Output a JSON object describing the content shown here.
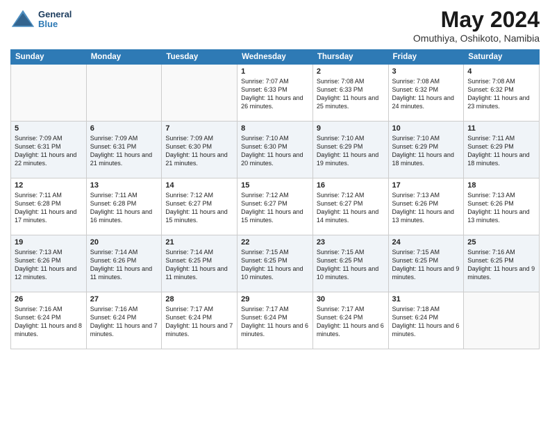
{
  "header": {
    "logo_general": "General",
    "logo_blue": "Blue",
    "title": "May 2024",
    "location": "Omuthiya, Oshikoto, Namibia"
  },
  "weekdays": [
    "Sunday",
    "Monday",
    "Tuesday",
    "Wednesday",
    "Thursday",
    "Friday",
    "Saturday"
  ],
  "weeks": [
    [
      {
        "day": "",
        "info": ""
      },
      {
        "day": "",
        "info": ""
      },
      {
        "day": "",
        "info": ""
      },
      {
        "day": "1",
        "info": "Sunrise: 7:07 AM\nSunset: 6:33 PM\nDaylight: 11 hours and 26 minutes."
      },
      {
        "day": "2",
        "info": "Sunrise: 7:08 AM\nSunset: 6:33 PM\nDaylight: 11 hours and 25 minutes."
      },
      {
        "day": "3",
        "info": "Sunrise: 7:08 AM\nSunset: 6:32 PM\nDaylight: 11 hours and 24 minutes."
      },
      {
        "day": "4",
        "info": "Sunrise: 7:08 AM\nSunset: 6:32 PM\nDaylight: 11 hours and 23 minutes."
      }
    ],
    [
      {
        "day": "5",
        "info": "Sunrise: 7:09 AM\nSunset: 6:31 PM\nDaylight: 11 hours and 22 minutes."
      },
      {
        "day": "6",
        "info": "Sunrise: 7:09 AM\nSunset: 6:31 PM\nDaylight: 11 hours and 21 minutes."
      },
      {
        "day": "7",
        "info": "Sunrise: 7:09 AM\nSunset: 6:30 PM\nDaylight: 11 hours and 21 minutes."
      },
      {
        "day": "8",
        "info": "Sunrise: 7:10 AM\nSunset: 6:30 PM\nDaylight: 11 hours and 20 minutes."
      },
      {
        "day": "9",
        "info": "Sunrise: 7:10 AM\nSunset: 6:29 PM\nDaylight: 11 hours and 19 minutes."
      },
      {
        "day": "10",
        "info": "Sunrise: 7:10 AM\nSunset: 6:29 PM\nDaylight: 11 hours and 18 minutes."
      },
      {
        "day": "11",
        "info": "Sunrise: 7:11 AM\nSunset: 6:29 PM\nDaylight: 11 hours and 18 minutes."
      }
    ],
    [
      {
        "day": "12",
        "info": "Sunrise: 7:11 AM\nSunset: 6:28 PM\nDaylight: 11 hours and 17 minutes."
      },
      {
        "day": "13",
        "info": "Sunrise: 7:11 AM\nSunset: 6:28 PM\nDaylight: 11 hours and 16 minutes."
      },
      {
        "day": "14",
        "info": "Sunrise: 7:12 AM\nSunset: 6:27 PM\nDaylight: 11 hours and 15 minutes."
      },
      {
        "day": "15",
        "info": "Sunrise: 7:12 AM\nSunset: 6:27 PM\nDaylight: 11 hours and 15 minutes."
      },
      {
        "day": "16",
        "info": "Sunrise: 7:12 AM\nSunset: 6:27 PM\nDaylight: 11 hours and 14 minutes."
      },
      {
        "day": "17",
        "info": "Sunrise: 7:13 AM\nSunset: 6:26 PM\nDaylight: 11 hours and 13 minutes."
      },
      {
        "day": "18",
        "info": "Sunrise: 7:13 AM\nSunset: 6:26 PM\nDaylight: 11 hours and 13 minutes."
      }
    ],
    [
      {
        "day": "19",
        "info": "Sunrise: 7:13 AM\nSunset: 6:26 PM\nDaylight: 11 hours and 12 minutes."
      },
      {
        "day": "20",
        "info": "Sunrise: 7:14 AM\nSunset: 6:26 PM\nDaylight: 11 hours and 11 minutes."
      },
      {
        "day": "21",
        "info": "Sunrise: 7:14 AM\nSunset: 6:25 PM\nDaylight: 11 hours and 11 minutes."
      },
      {
        "day": "22",
        "info": "Sunrise: 7:15 AM\nSunset: 6:25 PM\nDaylight: 11 hours and 10 minutes."
      },
      {
        "day": "23",
        "info": "Sunrise: 7:15 AM\nSunset: 6:25 PM\nDaylight: 11 hours and 10 minutes."
      },
      {
        "day": "24",
        "info": "Sunrise: 7:15 AM\nSunset: 6:25 PM\nDaylight: 11 hours and 9 minutes."
      },
      {
        "day": "25",
        "info": "Sunrise: 7:16 AM\nSunset: 6:25 PM\nDaylight: 11 hours and 9 minutes."
      }
    ],
    [
      {
        "day": "26",
        "info": "Sunrise: 7:16 AM\nSunset: 6:24 PM\nDaylight: 11 hours and 8 minutes."
      },
      {
        "day": "27",
        "info": "Sunrise: 7:16 AM\nSunset: 6:24 PM\nDaylight: 11 hours and 7 minutes."
      },
      {
        "day": "28",
        "info": "Sunrise: 7:17 AM\nSunset: 6:24 PM\nDaylight: 11 hours and 7 minutes."
      },
      {
        "day": "29",
        "info": "Sunrise: 7:17 AM\nSunset: 6:24 PM\nDaylight: 11 hours and 6 minutes."
      },
      {
        "day": "30",
        "info": "Sunrise: 7:17 AM\nSunset: 6:24 PM\nDaylight: 11 hours and 6 minutes."
      },
      {
        "day": "31",
        "info": "Sunrise: 7:18 AM\nSunset: 6:24 PM\nDaylight: 11 hours and 6 minutes."
      },
      {
        "day": "",
        "info": ""
      }
    ]
  ]
}
